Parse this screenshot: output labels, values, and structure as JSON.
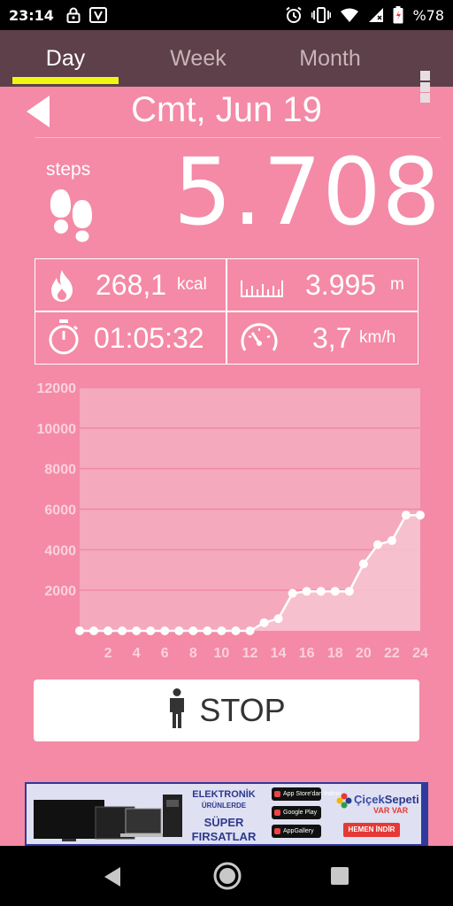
{
  "status_bar": {
    "time": "23:14",
    "battery": "%78",
    "icons_left": [
      "lock-icon",
      "app-icon"
    ],
    "icons_right": [
      "alarm-icon",
      "vibrate-icon",
      "wifi-icon",
      "signal-icon",
      "battery-icon"
    ]
  },
  "tabs": [
    {
      "label": "Day",
      "active": true
    },
    {
      "label": "Week",
      "active": false
    },
    {
      "label": "Month",
      "active": false
    }
  ],
  "date": "Cmt, Jun 19",
  "steps": {
    "label": "steps",
    "value": "5.708"
  },
  "stats": {
    "calories": {
      "value": "268,1",
      "unit": "kcal",
      "icon": "flame-icon"
    },
    "distance": {
      "value": "3.995",
      "unit": "m",
      "icon": "ruler-icon"
    },
    "duration": {
      "value": "01:05:32",
      "icon": "stopwatch-icon"
    },
    "speed": {
      "value": "3,7",
      "unit": "km/h",
      "icon": "speedometer-icon"
    }
  },
  "chart_data": {
    "type": "area",
    "x": [
      0,
      1,
      2,
      3,
      4,
      5,
      6,
      7,
      8,
      9,
      10,
      11,
      12,
      13,
      14,
      15,
      16,
      17,
      18,
      19,
      20,
      21,
      22,
      23,
      24
    ],
    "values": [
      0,
      0,
      0,
      0,
      0,
      0,
      0,
      0,
      0,
      0,
      0,
      0,
      0,
      400,
      600,
      1850,
      1950,
      1950,
      1950,
      1950,
      3300,
      4250,
      4450,
      5708,
      5708
    ],
    "xticks": [
      "2",
      "4",
      "6",
      "8",
      "10",
      "12",
      "14",
      "16",
      "18",
      "20",
      "22",
      "24"
    ],
    "yticks": [
      "2000",
      "4000",
      "6000",
      "8000",
      "10000",
      "12000"
    ],
    "xlim": [
      0,
      24
    ],
    "ylim": [
      0,
      12000
    ],
    "grid": true,
    "colors": {
      "fill": "#f7c4d1",
      "line": "#ffffff",
      "grid": "#f08aa4",
      "tick": "#fbd2dd"
    }
  },
  "stop_button": {
    "label": "STOP",
    "icon": "person-icon"
  },
  "ad": {
    "line1": "ELEKTRONİK",
    "line2": "ÜRÜNLERDE",
    "line3": "SÜPER",
    "line4": "FIRSATLAR",
    "badges": [
      "App Store'dan İndirin",
      "Google Play",
      "AppGallery"
    ],
    "brand_part1": "Çiçek",
    "brand_part2": "Sepeti",
    "brand_sub": "VAR VAR",
    "cta": "HEMEN İNDİR"
  }
}
